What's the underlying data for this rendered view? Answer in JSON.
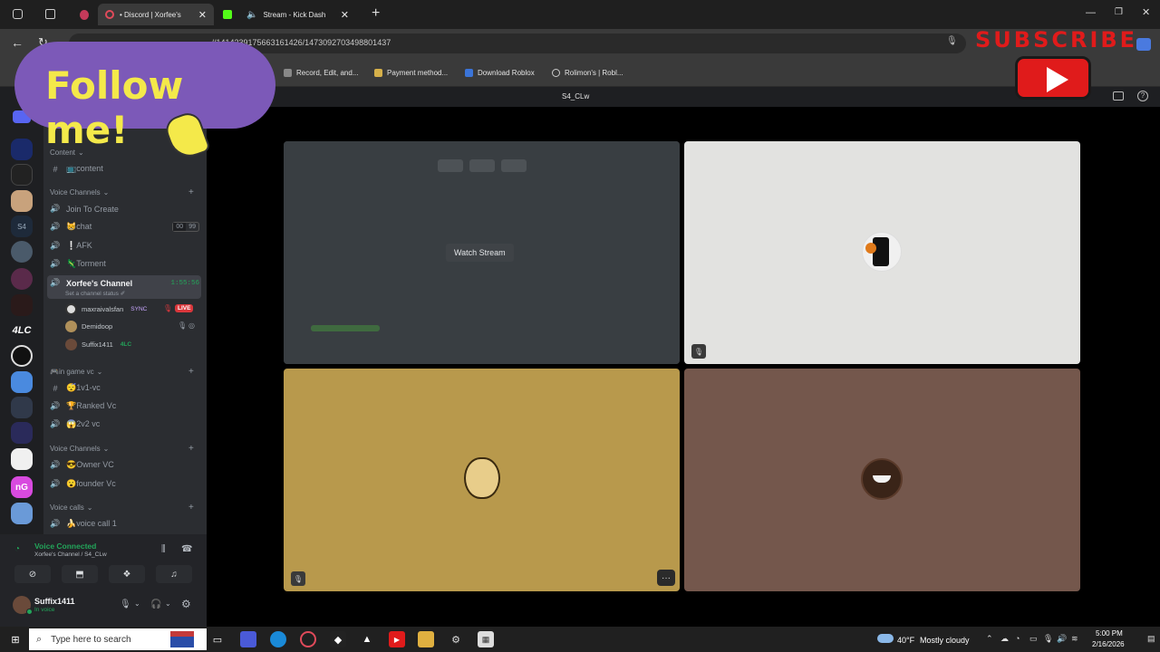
{
  "browser": {
    "tabs": [
      {
        "label": "• Discord | Xorfee's"
      },
      {
        "label": "Stream - Kick Dash"
      }
    ],
    "url": "...//1414239175663161426/1473092703498801437",
    "bookmarks": [
      {
        "label": "Record, Edit, and..."
      },
      {
        "label": "Payment method..."
      },
      {
        "label": "Download Roblox"
      },
      {
        "label": "Rolimon's | Robl..."
      }
    ]
  },
  "discord": {
    "channel_title": "S4_CLw",
    "sidebar": {
      "categories": [
        {
          "label": "Content"
        },
        {
          "label": "Voice Channels"
        },
        {
          "label": "🎮in game vc"
        },
        {
          "label": "Voice Channels"
        },
        {
          "label": "Voice calls"
        }
      ],
      "channels": {
        "content": "📺content",
        "join": "Join To Create",
        "chat": "😸chat",
        "chat_count_a": "00",
        "chat_count_b": "99",
        "afk": "❕AFK",
        "torment": "🦎Torment",
        "xorfee": "Xorfee's Channel",
        "xorfee_time": "1:55:56",
        "xorfee_status": "Set a channel status ✐",
        "v1": "😴1v1-vc",
        "ranked": "🏆Ranked Vc",
        "v2": "😱2v2 vc",
        "owner": "😎Owner VC",
        "founder": "😮founder Vc",
        "call": "🍌voice call 1"
      },
      "members": [
        {
          "name": "maxraivalsfan",
          "tag": "SYNC",
          "live": "LIVE"
        },
        {
          "name": "Demidoop"
        },
        {
          "name": "Suffix1411",
          "tag": "4LC"
        }
      ],
      "server_labels": {
        "s4": "S4",
        "lc": "4LC",
        "ng": "nG"
      }
    },
    "voice": {
      "status": "Voice Connected",
      "location": "Xorfee's Channel / S4_CLw"
    },
    "user": {
      "name": "Suffix1411",
      "state": "In voice"
    },
    "stage": {
      "watch_stream": "Watch Stream"
    }
  },
  "taskbar": {
    "search_placeholder": "Type here to search",
    "weather_temp": "40°F",
    "weather_desc": "Mostly cloudy",
    "time": "5:00 PM",
    "date": "2/16/2026"
  },
  "overlay": {
    "follow": "Follow me!",
    "subscribe": "SUBSCRIBE"
  },
  "colors": {
    "accent_green": "#23a55a",
    "live_red": "#da373c",
    "follow_purple": "#7c59b8",
    "follow_text": "#f4e94a",
    "youtube_red": "#e01b1b",
    "tile_gray": "#e2e2e0",
    "tile_mustard": "#b8994c",
    "tile_brown": "#74574c"
  }
}
